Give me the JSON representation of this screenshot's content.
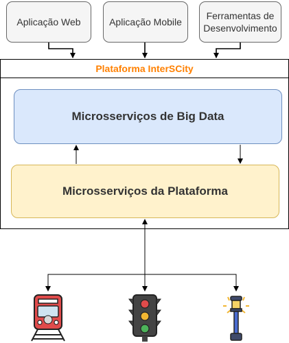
{
  "clients": [
    {
      "label": "Aplicação Web"
    },
    {
      "label": "Aplicação Mobile"
    },
    {
      "label": "Ferramentas de\nDesenvolvimento"
    }
  ],
  "platform": {
    "title": "Plataforma InterSCity",
    "title_color": "#ff8000",
    "big_data_label": "Microsserviços de Big Data",
    "platform_label": "Microsserviços da Plataforma",
    "big_data_fill": "#dae8fc",
    "platform_fill": "#fff2cc"
  },
  "devices": [
    {
      "icon": "train-icon"
    },
    {
      "icon": "traffic-light-icon"
    },
    {
      "icon": "street-lamp-icon"
    }
  ]
}
